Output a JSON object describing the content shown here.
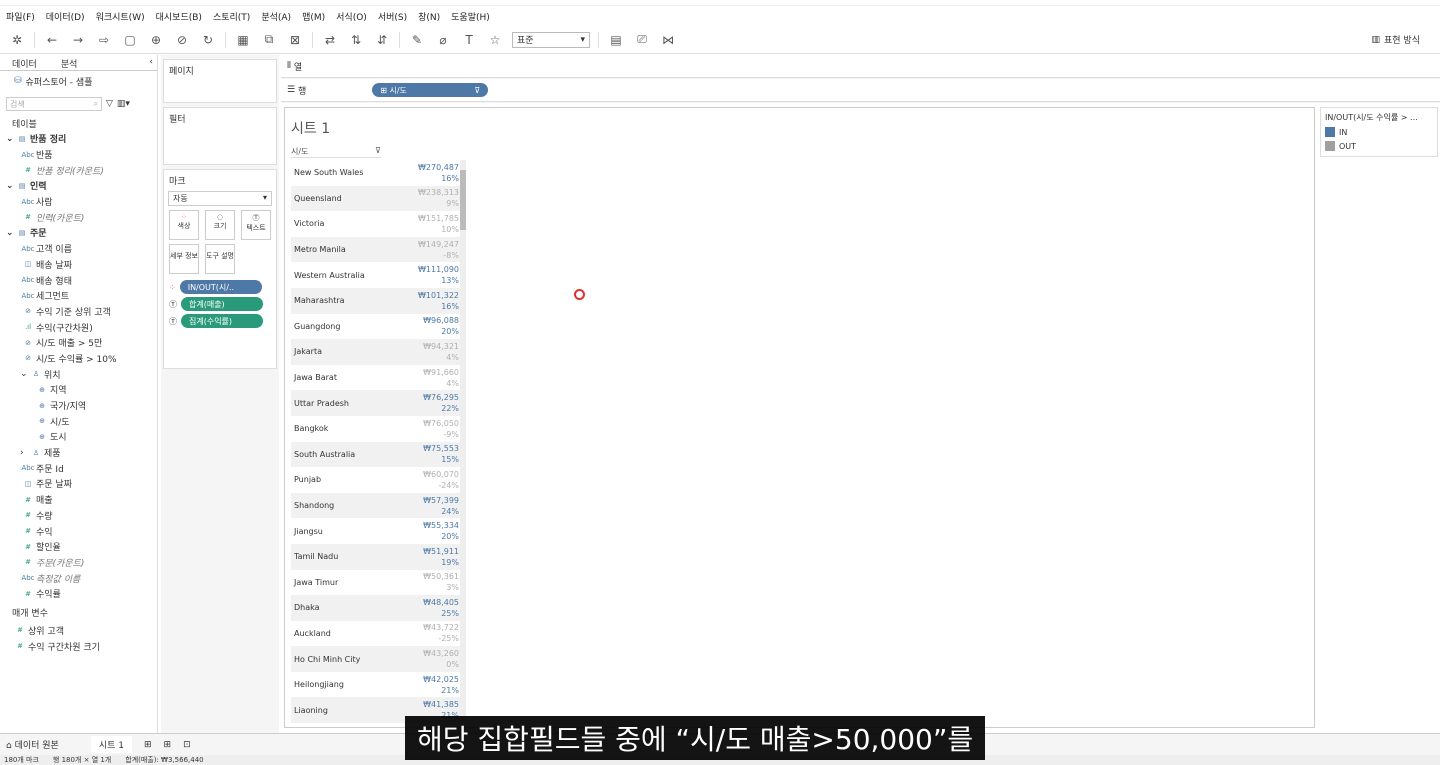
{
  "menu": [
    "파일(F)",
    "데이터(D)",
    "워크시트(W)",
    "대시보드(B)",
    "스토리(T)",
    "분석(A)",
    "맵(M)",
    "서식(O)",
    "서버(S)",
    "창(N)",
    "도움말(H)"
  ],
  "toolbar": {
    "fit": "표준",
    "show_me": "표현 방식"
  },
  "left": {
    "tab_data": "데이터",
    "tab_analysis": "분석",
    "datasource": "슈퍼스토어 - 샘플",
    "search_placeholder": "검색",
    "tables_label": "테이블",
    "fields": [
      {
        "t": "반품 정리",
        "k": "sect"
      },
      {
        "t": "반품",
        "k": "abc"
      },
      {
        "t": "반품 정리(카운트)",
        "k": "num",
        "i": true
      },
      {
        "t": "인력",
        "k": "sect"
      },
      {
        "t": "사람",
        "k": "abc"
      },
      {
        "t": "인력(카운트)",
        "k": "num",
        "i": true
      },
      {
        "t": "주문",
        "k": "sect"
      },
      {
        "t": "고객 이름",
        "k": "abc"
      },
      {
        "t": "배송 날짜",
        "k": "date"
      },
      {
        "t": "배송 형태",
        "k": "abc"
      },
      {
        "t": "세그먼트",
        "k": "abc"
      },
      {
        "t": "수익 기준 상위 고객",
        "k": "set"
      },
      {
        "t": "수익(구간차원)",
        "k": "bin"
      },
      {
        "t": "시/도 매출 > 5만",
        "k": "set"
      },
      {
        "t": "시/도 수익률 > 10%",
        "k": "set"
      },
      {
        "t": "위치",
        "k": "hier"
      },
      {
        "t": "지역",
        "k": "geo"
      },
      {
        "t": "국가/지역",
        "k": "geo"
      },
      {
        "t": "시/도",
        "k": "geo"
      },
      {
        "t": "도시",
        "k": "geo"
      },
      {
        "t": "제품",
        "k": "hier"
      },
      {
        "t": "주문 Id",
        "k": "abc"
      },
      {
        "t": "주문 날짜",
        "k": "date"
      },
      {
        "t": "매출",
        "k": "num"
      },
      {
        "t": "수량",
        "k": "num"
      },
      {
        "t": "수익",
        "k": "num"
      },
      {
        "t": "할인율",
        "k": "num"
      },
      {
        "t": "주문(카운트)",
        "k": "num",
        "i": true
      },
      {
        "t": "측정값 이름",
        "k": "abc",
        "i": true
      },
      {
        "t": "수익률",
        "k": "num"
      }
    ],
    "params_label": "매개 변수",
    "params": [
      "상위 고객",
      "수익 구간차원 크기"
    ]
  },
  "shelves": {
    "pages": "페이지",
    "filters": "필터",
    "marks": "마크",
    "mark_type": "자동",
    "mark_buttons": [
      "색상",
      "크기",
      "텍스트",
      "세부 정보",
      "도구 설명"
    ],
    "mark_pills": [
      "IN/OUT(시/..",
      "합계(매출)",
      "집계(수익률)"
    ],
    "columns": "열",
    "rows": "행",
    "row_pill": "시/도"
  },
  "sheet": {
    "title": "시트 1",
    "header": "시/도",
    "rows": [
      [
        "New South Wales",
        "₩270,487",
        "16%",
        "in"
      ],
      [
        "Queensland",
        "₩238,313",
        "9%",
        "out"
      ],
      [
        "Victoria",
        "₩151,785",
        "10%",
        "out"
      ],
      [
        "Metro Manila",
        "₩149,247",
        "-8%",
        "out"
      ],
      [
        "Western Australia",
        "₩111,090",
        "13%",
        "in"
      ],
      [
        "Maharashtra",
        "₩101,322",
        "16%",
        "in"
      ],
      [
        "Guangdong",
        "₩96,088",
        "20%",
        "in"
      ],
      [
        "Jakarta",
        "₩94,321",
        "4%",
        "out"
      ],
      [
        "Jawa Barat",
        "₩91,660",
        "4%",
        "out"
      ],
      [
        "Uttar Pradesh",
        "₩76,295",
        "22%",
        "in"
      ],
      [
        "Bangkok",
        "₩76,050",
        "-9%",
        "out"
      ],
      [
        "South Australia",
        "₩75,553",
        "15%",
        "in"
      ],
      [
        "Punjab",
        "₩60,070",
        "-24%",
        "out"
      ],
      [
        "Shandong",
        "₩57,399",
        "24%",
        "in"
      ],
      [
        "Jiangsu",
        "₩55,334",
        "20%",
        "in"
      ],
      [
        "Tamil Nadu",
        "₩51,911",
        "19%",
        "in"
      ],
      [
        "Jawa Timur",
        "₩50,361",
        "3%",
        "out"
      ],
      [
        "Dhaka",
        "₩48,405",
        "25%",
        "in"
      ],
      [
        "Auckland",
        "₩43,722",
        "-25%",
        "out"
      ],
      [
        "Ho Chi Minh City",
        "₩43,260",
        "0%",
        "out"
      ],
      [
        "Heilongjiang",
        "₩42,025",
        "21%",
        "in"
      ],
      [
        "Liaoning",
        "₩41,385",
        "21%",
        "in"
      ]
    ]
  },
  "legend": {
    "title": "IN/OUT(시/도 수익률 > ...",
    "in": "IN",
    "out": "OUT",
    "in_color": "#4e79a7",
    "out_color": "#a0a0a0"
  },
  "bottom": {
    "datasource_tab": "데이터 원본",
    "sheet_tab": "시트 1"
  },
  "status": [
    "180개 마크",
    "행 180개 × 열 1개",
    "합계(매출): ₩3,566,440"
  ],
  "subtitle": "해당 집합필드들 중에 “시/도 매출>50,000”를"
}
